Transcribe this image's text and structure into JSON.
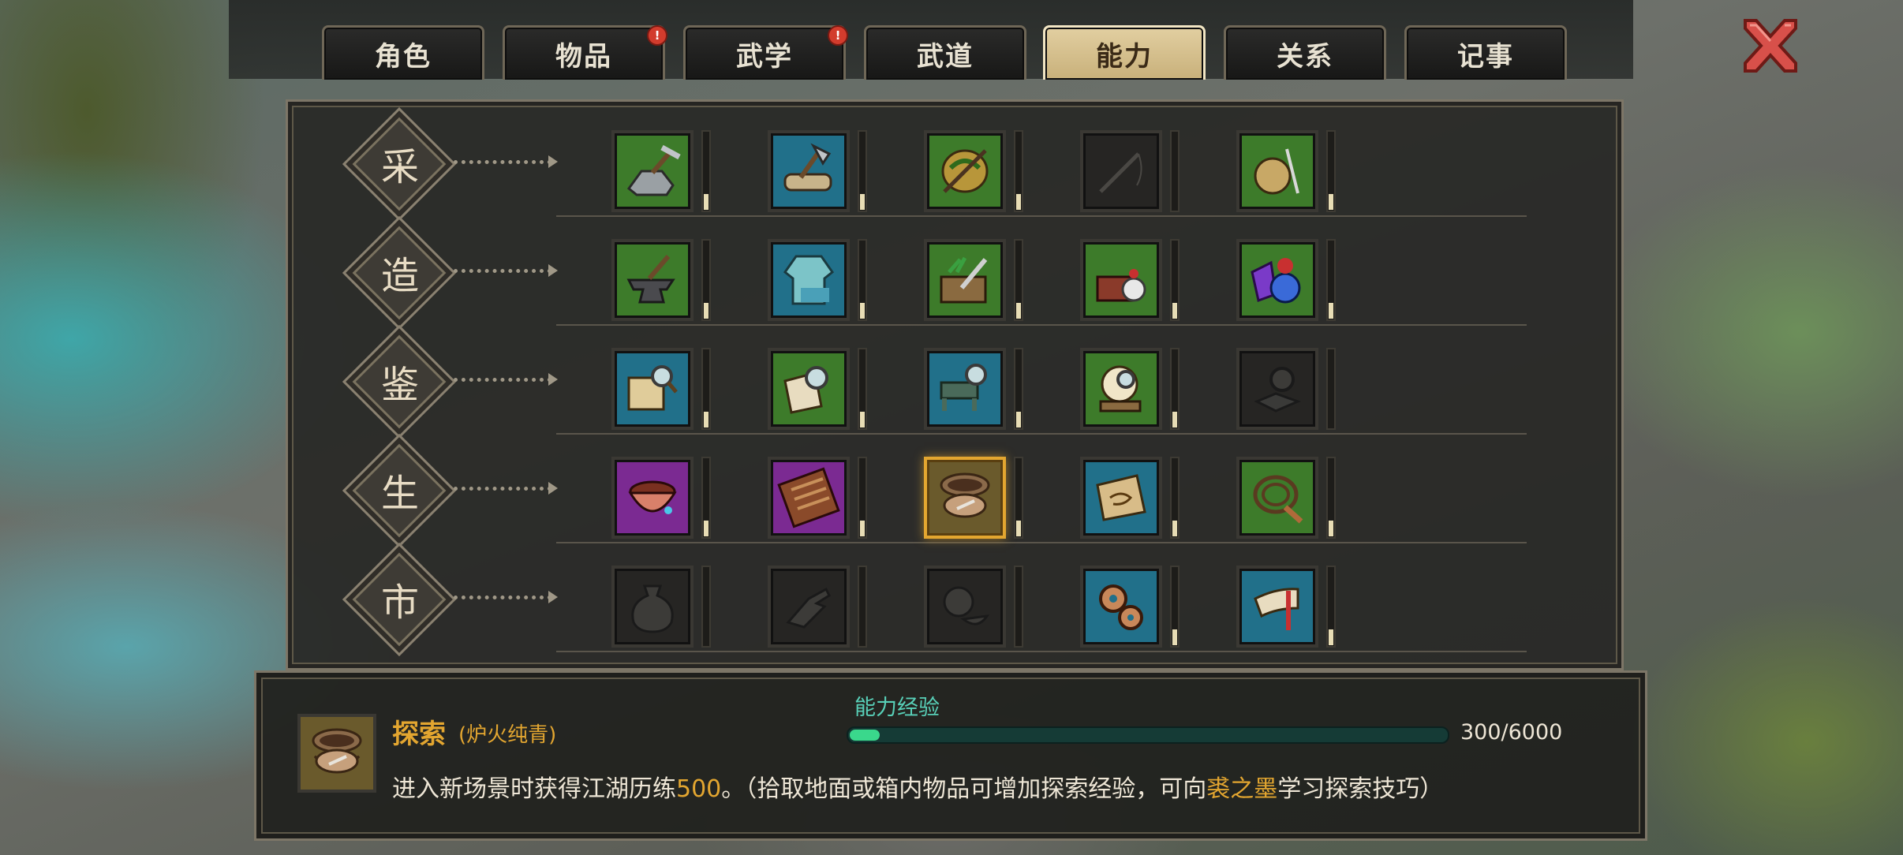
{
  "tabs": [
    {
      "label": "角色",
      "badge": null,
      "active": false
    },
    {
      "label": "物品",
      "badge": "!",
      "active": false
    },
    {
      "label": "武学",
      "badge": "!",
      "active": false
    },
    {
      "label": "武道",
      "badge": null,
      "active": false
    },
    {
      "label": "能力",
      "badge": null,
      "active": true
    },
    {
      "label": "关系",
      "badge": null,
      "active": false
    },
    {
      "label": "记事",
      "badge": null,
      "active": false
    }
  ],
  "close_icon": "close-x-icon",
  "categories": [
    {
      "label": "采",
      "skills": [
        {
          "icon": "pickaxe-ore-icon",
          "bg": "green",
          "level": 0.2
        },
        {
          "icon": "axe-log-icon",
          "bg": "blue",
          "level": 0.2
        },
        {
          "icon": "herb-basket-icon",
          "bg": "green",
          "level": 0.2
        },
        {
          "icon": "fishing-rod-icon",
          "bg": "dark",
          "level": 0
        },
        {
          "icon": "yarn-needle-icon",
          "bg": "green",
          "level": 0.2
        }
      ]
    },
    {
      "label": "造",
      "skills": [
        {
          "icon": "anvil-hammer-icon",
          "bg": "green",
          "level": 0.2
        },
        {
          "icon": "tailored-robe-icon",
          "bg": "blue",
          "level": 0.2
        },
        {
          "icon": "cutting-board-icon",
          "bg": "green",
          "level": 0.2
        },
        {
          "icon": "mortar-pestle-icon",
          "bg": "green",
          "level": 0.2
        },
        {
          "icon": "gem-potion-icon",
          "bg": "green",
          "level": 0.2
        }
      ]
    },
    {
      "label": "鉴",
      "skills": [
        {
          "icon": "scroll-magnifier-icon",
          "bg": "blue",
          "level": 0.2
        },
        {
          "icon": "cloth-magnifier-icon",
          "bg": "green",
          "level": 0.2
        },
        {
          "icon": "furniture-magnifier-icon",
          "bg": "blue",
          "level": 0.2
        },
        {
          "icon": "antique-magnifier-icon",
          "bg": "green",
          "level": 0.2
        },
        {
          "icon": "stone-magnifier-icon",
          "bg": "dark",
          "level": 0
        }
      ]
    },
    {
      "label": "生",
      "skills": [
        {
          "icon": "bowl-icon",
          "bg": "purple",
          "level": 0.2
        },
        {
          "icon": "abacus-icon",
          "bg": "purple",
          "level": 0.2
        },
        {
          "icon": "explore-pot-icon",
          "bg": "selected",
          "level": 0.2
        },
        {
          "icon": "map-icon",
          "bg": "blue",
          "level": 0.2
        },
        {
          "icon": "whip-icon",
          "bg": "green",
          "level": 0.2
        }
      ]
    },
    {
      "label": "市",
      "skills": [
        {
          "icon": "money-bag-icon",
          "bg": "dark",
          "level": 0
        },
        {
          "icon": "hand-icon",
          "bg": "dark",
          "level": 0
        },
        {
          "icon": "pot-icon",
          "bg": "dark",
          "level": 0
        },
        {
          "icon": "gears-icon",
          "bg": "blue",
          "level": 0.2
        },
        {
          "icon": "horn-icon",
          "bg": "blue",
          "level": 0.2
        }
      ]
    }
  ],
  "detail": {
    "icon": "explore-pot-icon",
    "name": "探索",
    "subtitle": "(炉火纯青)",
    "xp_label": "能力经验",
    "xp_current": 300,
    "xp_max": 6000,
    "xp_text": "300/6000",
    "desc_prefix": "进入新场景时获得江湖历练",
    "desc_value": "500",
    "desc_middle": "。（拾取地面或箱内物品可增加探索经验，可向",
    "desc_person": "裘之墨",
    "desc_suffix": "学习探索技巧）"
  },
  "colors": {
    "accent": "#e3a630",
    "xp_fill": "#3ad88c",
    "xp_label": "#58d0b8",
    "tab_active": "#d8c08b"
  }
}
